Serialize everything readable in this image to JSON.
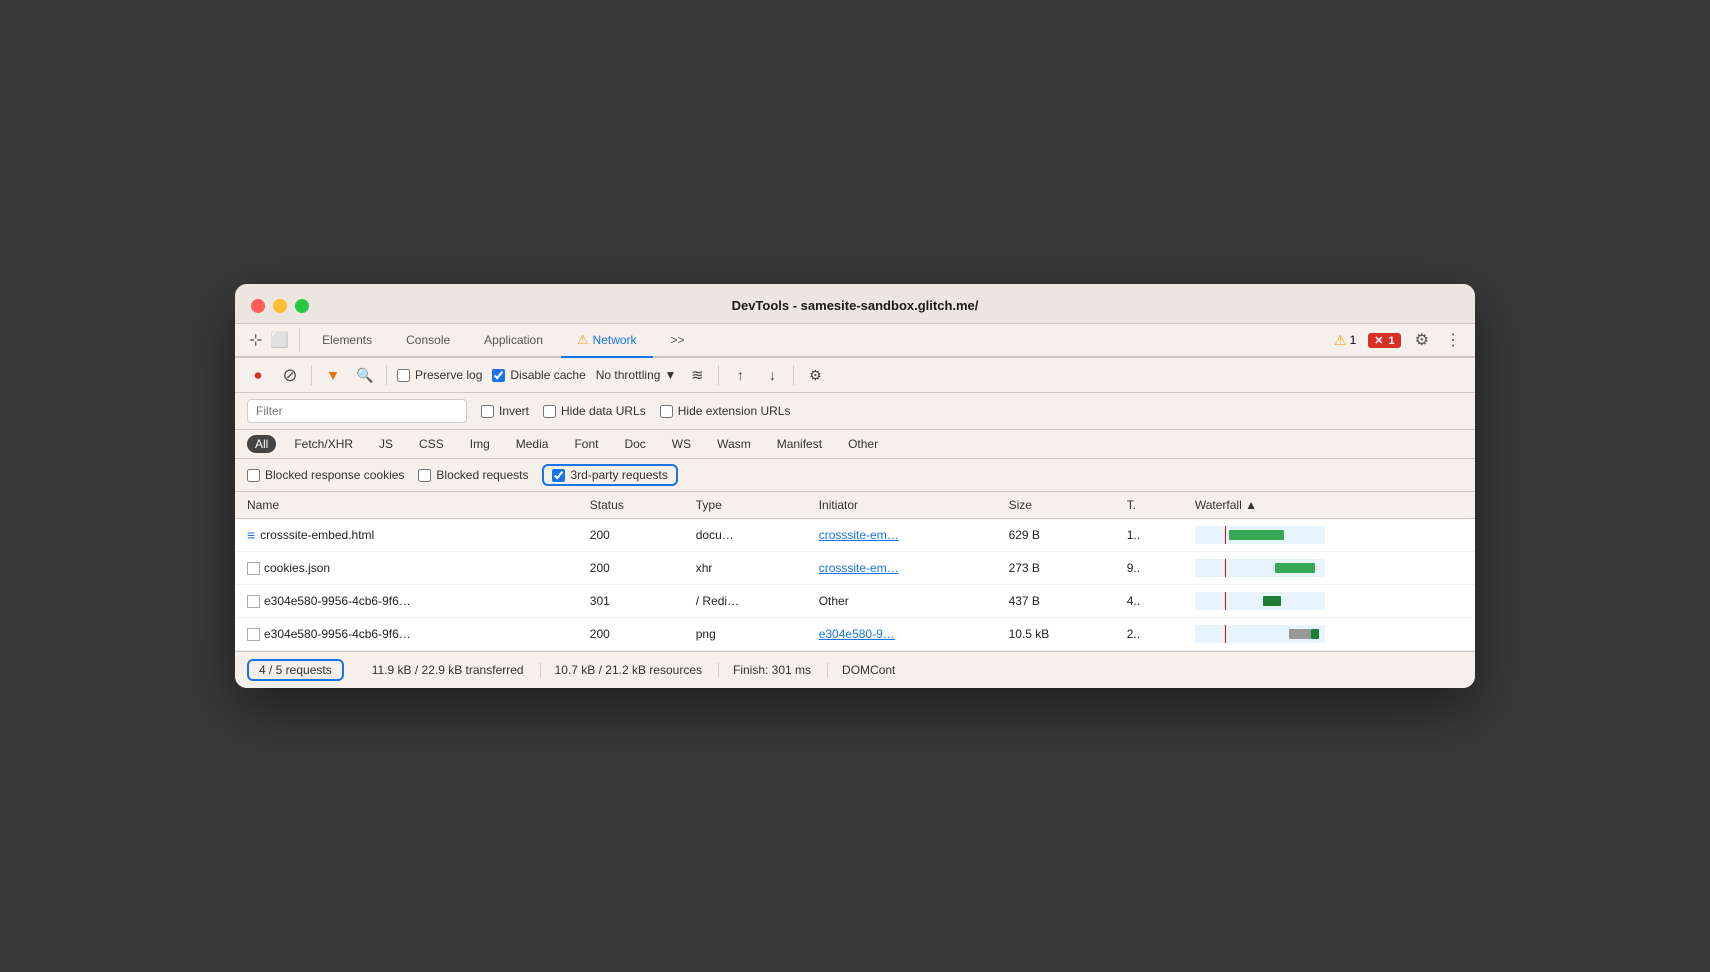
{
  "window": {
    "title": "DevTools - samesite-sandbox.glitch.me/"
  },
  "tabs": [
    {
      "id": "elements",
      "label": "Elements",
      "active": false
    },
    {
      "id": "console",
      "label": "Console",
      "active": false
    },
    {
      "id": "application",
      "label": "Application",
      "active": false
    },
    {
      "id": "network",
      "label": "Network",
      "active": true,
      "has_warning": true
    },
    {
      "id": "more",
      "label": ">>",
      "active": false
    }
  ],
  "tab_icons": {
    "cursor": "⊹",
    "phone": "⬜"
  },
  "warning_count": "1",
  "error_count": "1",
  "toolbar2": {
    "stop": "⏺",
    "clear": "🚫",
    "filter": "▼",
    "search": "🔍",
    "preserve_log": "Preserve log",
    "disable_cache": "Disable cache",
    "throttle": "No throttling",
    "wifi": "≋",
    "upload": "↑",
    "download": "↓",
    "settings": "⚙"
  },
  "filter": {
    "placeholder": "Filter",
    "invert": "Invert",
    "hide_data_urls": "Hide data URLs",
    "hide_extension_urls": "Hide extension URLs"
  },
  "type_filters": [
    {
      "id": "all",
      "label": "All",
      "active": true
    },
    {
      "id": "fetch_xhr",
      "label": "Fetch/XHR",
      "active": false
    },
    {
      "id": "js",
      "label": "JS",
      "active": false
    },
    {
      "id": "css",
      "label": "CSS",
      "active": false
    },
    {
      "id": "img",
      "label": "Img",
      "active": false
    },
    {
      "id": "media",
      "label": "Media",
      "active": false
    },
    {
      "id": "font",
      "label": "Font",
      "active": false
    },
    {
      "id": "doc",
      "label": "Doc",
      "active": false
    },
    {
      "id": "ws",
      "label": "WS",
      "active": false
    },
    {
      "id": "wasm",
      "label": "Wasm",
      "active": false
    },
    {
      "id": "manifest",
      "label": "Manifest",
      "active": false
    },
    {
      "id": "other",
      "label": "Other",
      "active": false
    }
  ],
  "blocked_filters": {
    "blocked_response_cookies": "Blocked response cookies",
    "blocked_requests": "Blocked requests",
    "third_party_requests": "3rd-party requests",
    "third_party_checked": true
  },
  "table": {
    "columns": [
      {
        "id": "name",
        "label": "Name"
      },
      {
        "id": "status",
        "label": "Status"
      },
      {
        "id": "type",
        "label": "Type"
      },
      {
        "id": "initiator",
        "label": "Initiator"
      },
      {
        "id": "size",
        "label": "Size"
      },
      {
        "id": "time",
        "label": "T."
      },
      {
        "id": "waterfall",
        "label": "Waterfall",
        "sortable": true
      }
    ],
    "rows": [
      {
        "name": "crosssite-embed.html",
        "icon": "doc",
        "status": "200",
        "type": "docu…",
        "initiator": "crosssite-em…",
        "initiator_link": true,
        "size": "629 B",
        "time": "1..",
        "waterfall_type": "green_right"
      },
      {
        "name": "cookies.json",
        "icon": "empty",
        "status": "200",
        "type": "xhr",
        "initiator": "crosssite-em…",
        "initiator_link": true,
        "size": "273 B",
        "time": "9..",
        "waterfall_type": "green_far_right"
      },
      {
        "name": "e304e580-9956-4cb6-9f6…",
        "icon": "empty",
        "status": "301",
        "type": "/ Redi…",
        "initiator": "Other",
        "initiator_link": false,
        "size": "437 B",
        "time": "4..",
        "waterfall_type": "small_green_right"
      },
      {
        "name": "e304e580-9956-4cb6-9f6…",
        "icon": "empty",
        "status": "200",
        "type": "png",
        "initiator": "e304e580-9…",
        "initiator_link": true,
        "size": "10.5 kB",
        "time": "2..",
        "waterfall_type": "tiny_right"
      }
    ]
  },
  "status_bar": {
    "requests": "4 / 5 requests",
    "transferred": "11.9 kB / 22.9 kB transferred",
    "resources": "10.7 kB / 21.2 kB resources",
    "finish": "Finish: 301 ms",
    "domcont": "DOMCont"
  }
}
